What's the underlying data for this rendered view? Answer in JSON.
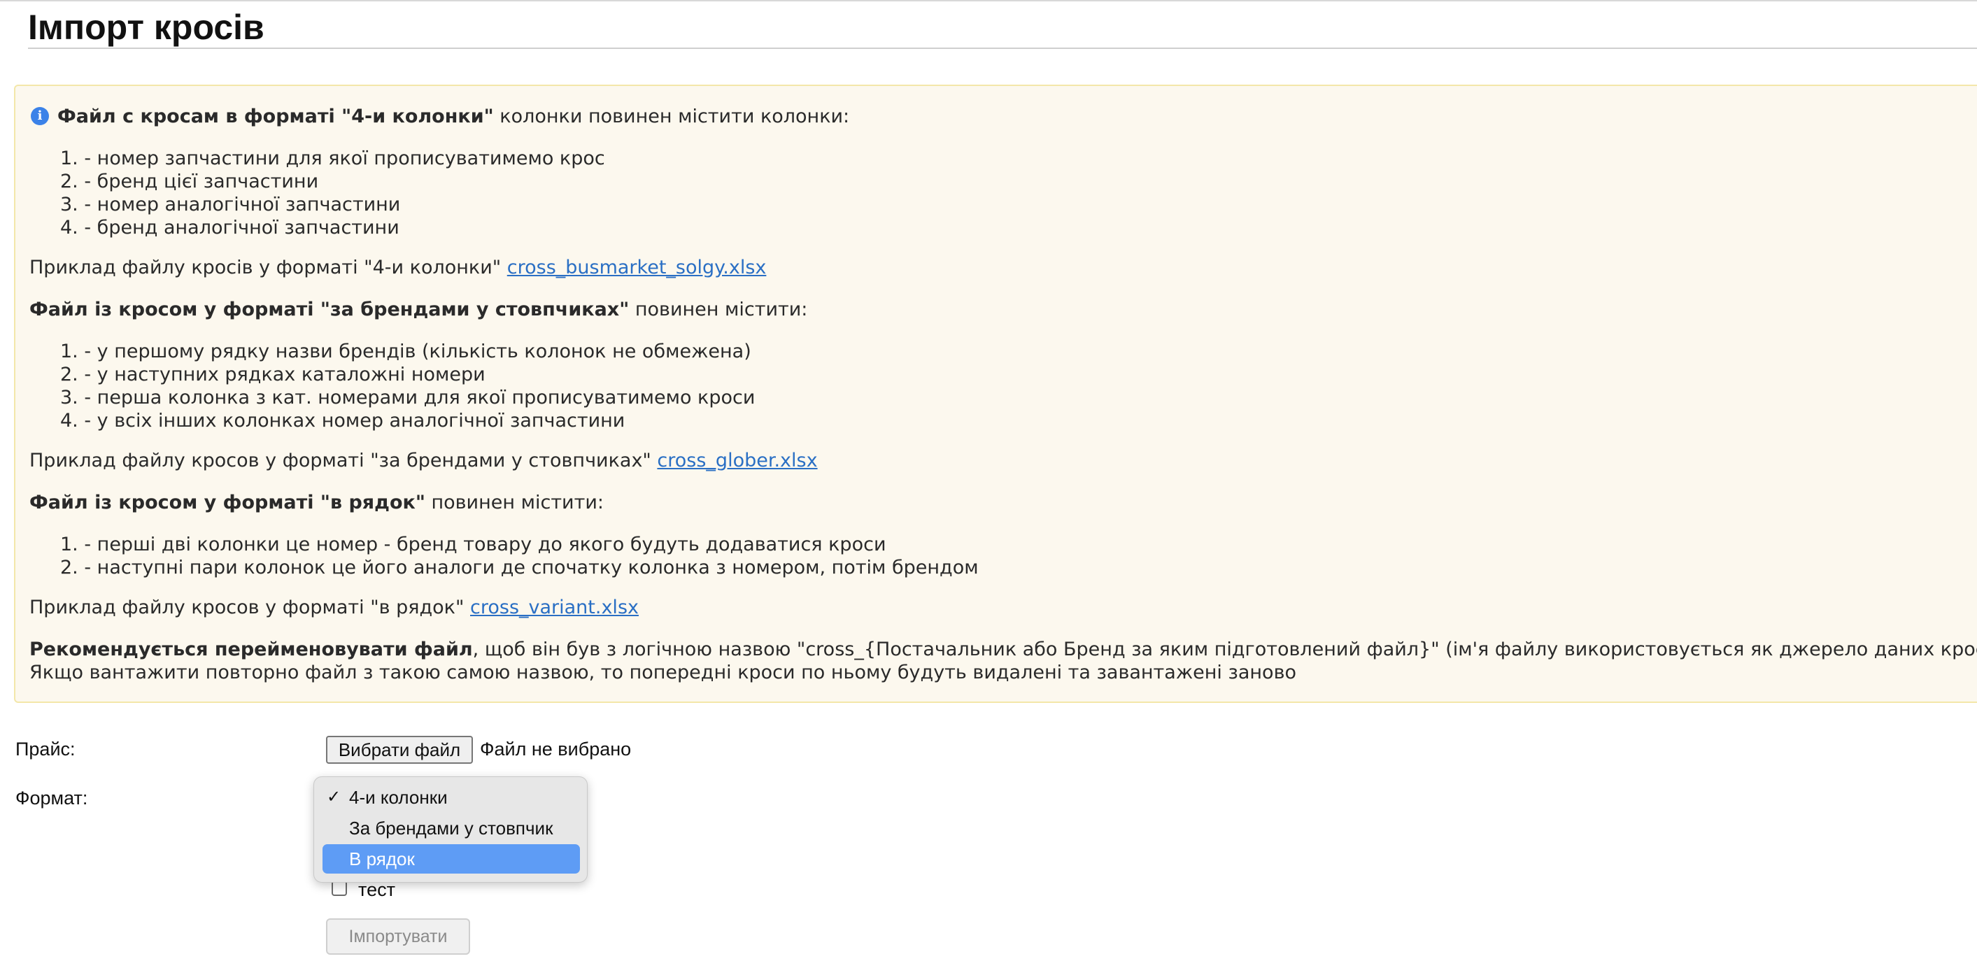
{
  "page": {
    "title": "Імпорт кросів"
  },
  "info": {
    "p1_bold": "Файл с кросам в форматі \"4-и колонки\"",
    "p1_rest": " колонки повинен містити колонки:",
    "list1": [
      "1. - номер запчастини для якої прописуватимемо крос",
      "2. - бренд цієї запчастини",
      "3. - номер аналогічної запчастини",
      "4. - бренд аналогічної запчастини"
    ],
    "example1_text": "Приклад файлу кросів у форматі \"4-и колонки\" ",
    "example1_link": "cross_busmarket_solgy.xlsx",
    "p2_bold": "Файл із кросом у форматі \"за брендами у стовпчиках\"",
    "p2_rest": " повинен містити:",
    "list2": [
      "1. - у першому рядку назви брендів (кількість колонок не обмежена)",
      "2. - у наступних рядках каталожні номери",
      "3. - перша колонка з кат. номерами для якої прописуватимемо кроси",
      "4. - у всіх інших колонках номер аналогічної запчастини"
    ],
    "example2_text": "Приклад файлу кросов у форматі \"за брендами у стовпчиках\" ",
    "example2_link": "cross_glober.xlsx",
    "p3_bold": "Файл із кросом у форматі \"в рядок\"",
    "p3_rest": " повинен містити:",
    "list3": [
      "1. - перші дві колонки це номер - бренд товару до якого будуть додаватися кроси",
      "2. - наступні пари колонок це його аналоги де спочатку колонка з номером, потім брендом"
    ],
    "example3_text": "Приклад файлу кросов у форматі \"в рядок\" ",
    "example3_link": "cross_variant.xlsx",
    "rec_bold": "Рекомендується перейменовувати файл",
    "rec_rest": ", щоб він був з логічною назвою \"cross_{Постачальник або Бренд за яким підготовлений файл}\" (ім'я файлу використовується як джерело даних кросів).",
    "rec_line2": "Якщо вантажити повторно файл з такою самою назвою, то попередні кроси по ньому будуть видалені та завантажені заново"
  },
  "form": {
    "price_label": "Прайс:",
    "file_button": "Вибрати файл",
    "file_status": "Файл не вибрано",
    "format_label": "Формат:",
    "format_options": [
      {
        "label": "4-и колонки",
        "checked": true,
        "highlighted": false
      },
      {
        "label": "За брендами у стовпчик",
        "checked": false,
        "highlighted": false
      },
      {
        "label": "В рядок",
        "checked": false,
        "highlighted": true
      }
    ],
    "checkmark": "✓",
    "test_label": "тест",
    "test_checked": false,
    "import_button": "Імпортувати"
  },
  "colors": {
    "info_bg": "#fcf8ee",
    "info_border": "#f3e7a9",
    "link": "#2a6fc4",
    "highlight": "#5e9cf5"
  },
  "icons": {
    "info": "info-circle-icon"
  }
}
